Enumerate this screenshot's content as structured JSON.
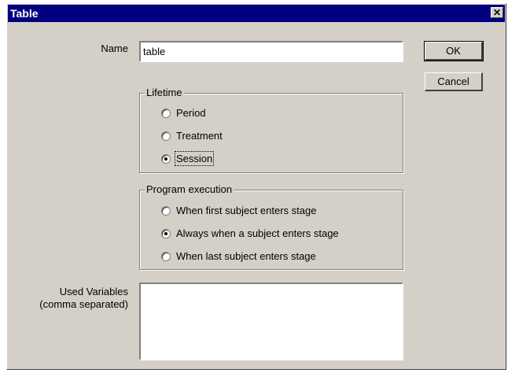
{
  "window": {
    "title": "Table",
    "close_glyph": "✕"
  },
  "form": {
    "name_label": "Name",
    "name_value": "table",
    "vars_label_line1": "Used Variables",
    "vars_label_line2": "(comma separated)",
    "vars_value": ""
  },
  "buttons": {
    "ok": "OK",
    "cancel": "Cancel"
  },
  "lifetime": {
    "legend": "Lifetime",
    "options": [
      {
        "label": "Period",
        "checked": false
      },
      {
        "label": "Treatment",
        "checked": false
      },
      {
        "label": "Session",
        "checked": true
      }
    ]
  },
  "execution": {
    "legend": "Program execution",
    "options": [
      {
        "label": "When first subject enters stage",
        "checked": false
      },
      {
        "label": "Always when a subject enters stage",
        "checked": true
      },
      {
        "label": "When last subject enters stage",
        "checked": false
      }
    ]
  }
}
